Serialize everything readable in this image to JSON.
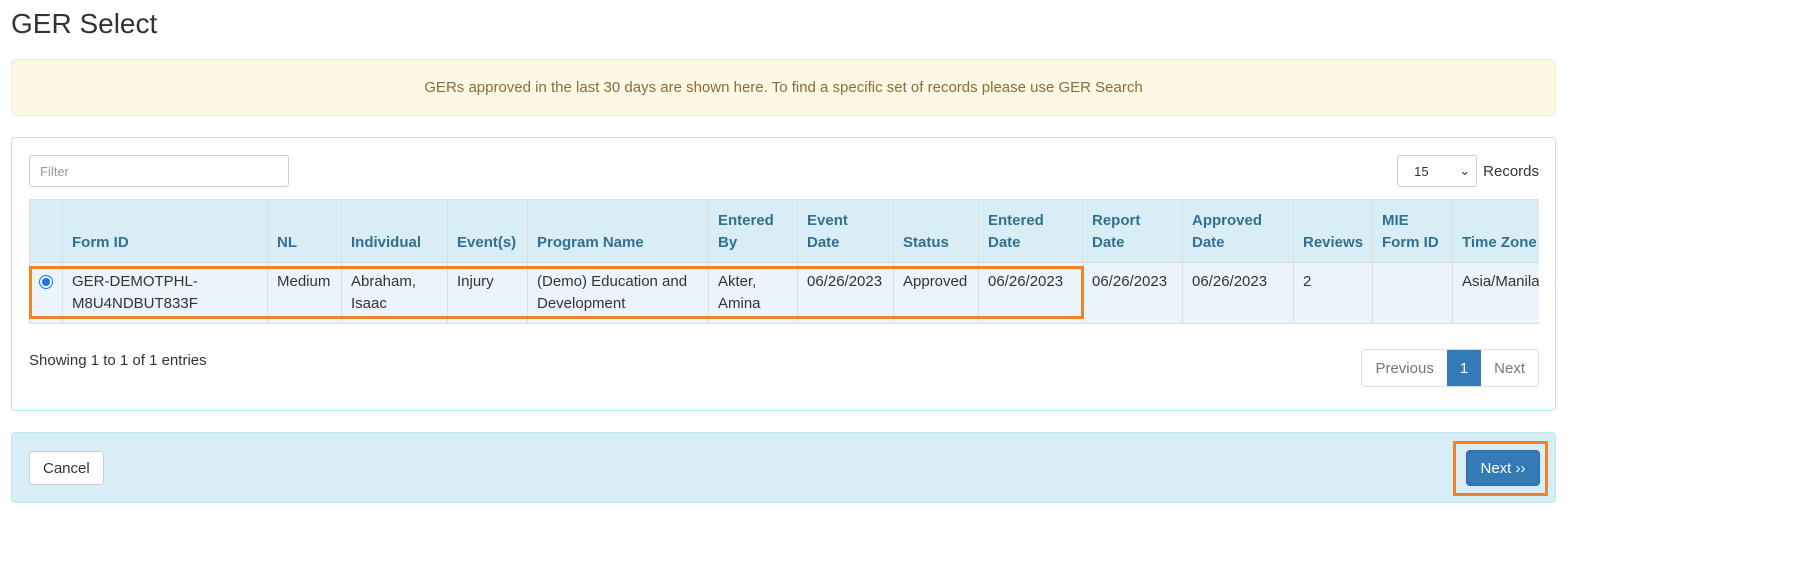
{
  "page_title": "GER Select",
  "alert": "GERs approved in the last 30 days are shown here. To find a specific set of records please use GER Search",
  "filter": {
    "placeholder": "Filter",
    "value": ""
  },
  "records": {
    "selected": "15",
    "label": "Records"
  },
  "table": {
    "headers": [
      "Form ID",
      "NL",
      "Individual",
      "Event(s)",
      "Program Name",
      "Entered By",
      "Event Date",
      "Status",
      "Entered Date",
      "Report Date",
      "Approved Date",
      "Reviews",
      "MIE Form ID",
      "Time Zone"
    ],
    "rows": [
      {
        "selected": true,
        "cells": [
          "GER-DEMOTPHL-M8U4NDBUT833F",
          "Medium",
          "Abraham, Isaac",
          "Injury",
          "(Demo) Education and Development",
          "Akter, Amina",
          "06/26/2023",
          "Approved",
          "06/26/2023",
          "06/26/2023",
          "06/26/2023",
          "2",
          "",
          "Asia/Manila"
        ]
      }
    ]
  },
  "showing": "Showing 1 to 1 of 1 entries",
  "pagination": {
    "previous": "Previous",
    "current": "1",
    "next": "Next"
  },
  "footer": {
    "cancel": "Cancel",
    "next": "Next ››"
  },
  "colors": {
    "highlight": "#f0832a",
    "primary": "#337ab7",
    "header_bg": "#d9edf7",
    "alert_bg": "#fcf8e3"
  }
}
